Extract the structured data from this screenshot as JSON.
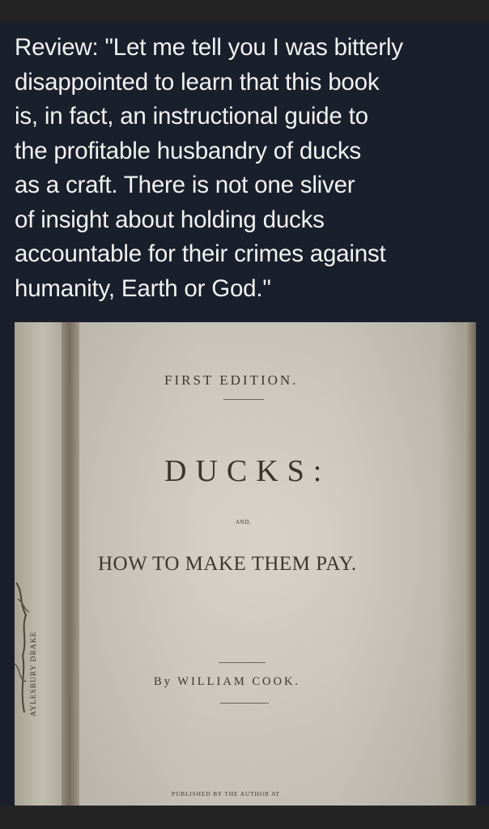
{
  "caption": {
    "lines": [
      "Review: \"Let me tell you I was bitterly",
      "disappointed to learn that this book",
      "is, in fact, an instructional guide to",
      "the profitable husbandry of ducks",
      "as a craft. There is not one sliver",
      "of insight about holding ducks",
      "accountable for their crimes against",
      "humanity, Earth or God.\""
    ]
  },
  "book_page": {
    "edition": "FIRST EDITION.",
    "title": "DUCKS:",
    "conjunction": "AND,",
    "subtitle": "HOW TO MAKE THEM PAY.",
    "byline": "By WILLIAM COOK.",
    "publisher_line": "PUBLISHED BY THE AUTHOR AT",
    "plate_caption": "AYLESBURY DRAKE"
  }
}
